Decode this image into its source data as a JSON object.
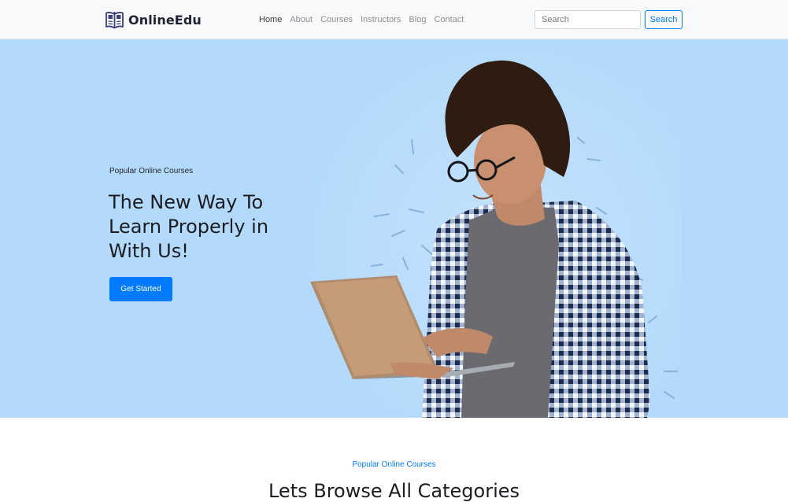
{
  "brand": {
    "name": "OnlineEdu",
    "icon": "open-book-icon",
    "color": "#1f2235"
  },
  "nav": {
    "items": [
      {
        "label": "Home",
        "active": true
      },
      {
        "label": "About",
        "active": false
      },
      {
        "label": "Courses",
        "active": false
      },
      {
        "label": "Instructors",
        "active": false
      },
      {
        "label": "Blog",
        "active": false
      },
      {
        "label": "Contact",
        "active": false
      }
    ]
  },
  "search": {
    "placeholder": "Search",
    "value": "",
    "button_label": "Search"
  },
  "hero": {
    "subtitle": "Popular Online Courses",
    "title": "The New Way To Learn Properly in With Us!",
    "cta_label": "Get Started",
    "background": "#b4dafb",
    "image": "student-with-laptop-photo"
  },
  "categories": {
    "subtitle": "Popular Online Courses",
    "title": "Lets Browse All Categories"
  },
  "colors": {
    "accent": "#007bff",
    "navbar_bg": "#f8f9fa",
    "text_dark": "#212529"
  }
}
